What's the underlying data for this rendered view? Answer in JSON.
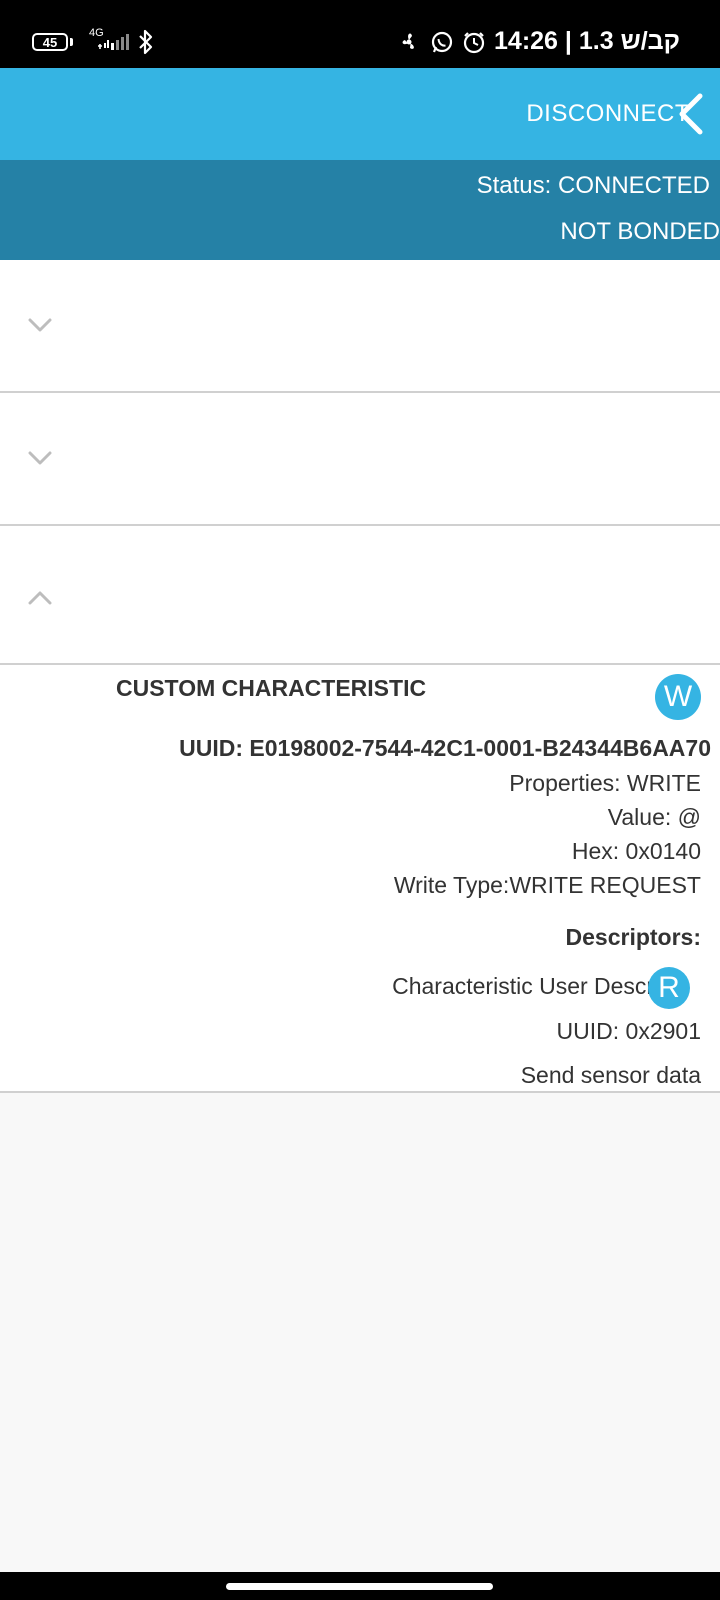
{
  "status_bar": {
    "battery": "45",
    "network": "4G",
    "time_text": "קב/ש 1.3 | 14:26",
    "icons": [
      "battery-icon",
      "signal-icon",
      "bluetooth-icon",
      "fan-icon",
      "whatsapp-icon",
      "alarm-icon"
    ]
  },
  "toolbar": {
    "disconnect_label": "DISCONNECT",
    "back_icon": "chevron-left-icon",
    "color": "#35b4e3"
  },
  "connection": {
    "status": "Status: CONNECTED",
    "bond": "NOT BONDED",
    "color": "#2581a6"
  },
  "services": [
    {
      "expanded": false,
      "icon": "chevron-down-icon"
    },
    {
      "expanded": false,
      "icon": "chevron-down-icon"
    },
    {
      "expanded": true,
      "icon": "chevron-up-icon"
    }
  ],
  "characteristic": {
    "name": "CUSTOM CHARACTERISTIC",
    "badge": "W",
    "uuid": "UUID: E0198002-7544-42C1-0001-B24344B6AA70",
    "properties": "Properties: WRITE",
    "value": "Value: @",
    "hex": "Hex: 0x0140",
    "write_type": "Write Type:WRITE REQUEST",
    "descriptors_title": "Descriptors:",
    "descriptor": {
      "name": "Characteristic User Descrip",
      "badge": "R",
      "uuid": "UUID: 0x2901",
      "value": "Send sensor data"
    }
  }
}
